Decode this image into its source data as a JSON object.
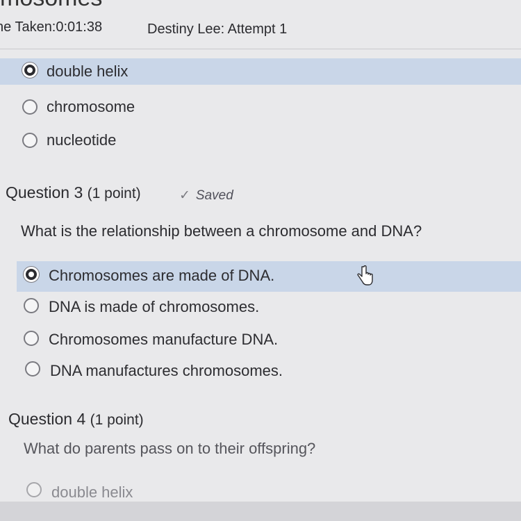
{
  "header": {
    "page_title_fragment": "mosomes",
    "time_taken": "ne Taken:0:01:38",
    "attempt": "Destiny Lee: Attempt 1"
  },
  "question2": {
    "options": [
      "double helix",
      "chromosome",
      "nucleotide"
    ],
    "selected_index": 0
  },
  "question3": {
    "title": "Question 3",
    "points": "(1 point)",
    "saved": "Saved",
    "text": "What is the relationship between a chromosome and DNA?",
    "options": [
      "Chromosomes are made of DNA.",
      "DNA is made of chromosomes.",
      "Chromosomes manufacture DNA.",
      "DNA manufactures chromosomes."
    ],
    "selected_index": 0
  },
  "question4": {
    "title": "Question 4",
    "points": "(1 point)",
    "text": "What do parents pass on to their offspring?",
    "options": [
      "double helix"
    ]
  },
  "icons": {
    "saved": "checkmark-icon",
    "cursor": "hand-pointer-icon"
  },
  "colors": {
    "selected_row": "#c9d6e8",
    "background": "#e9e9eb"
  }
}
